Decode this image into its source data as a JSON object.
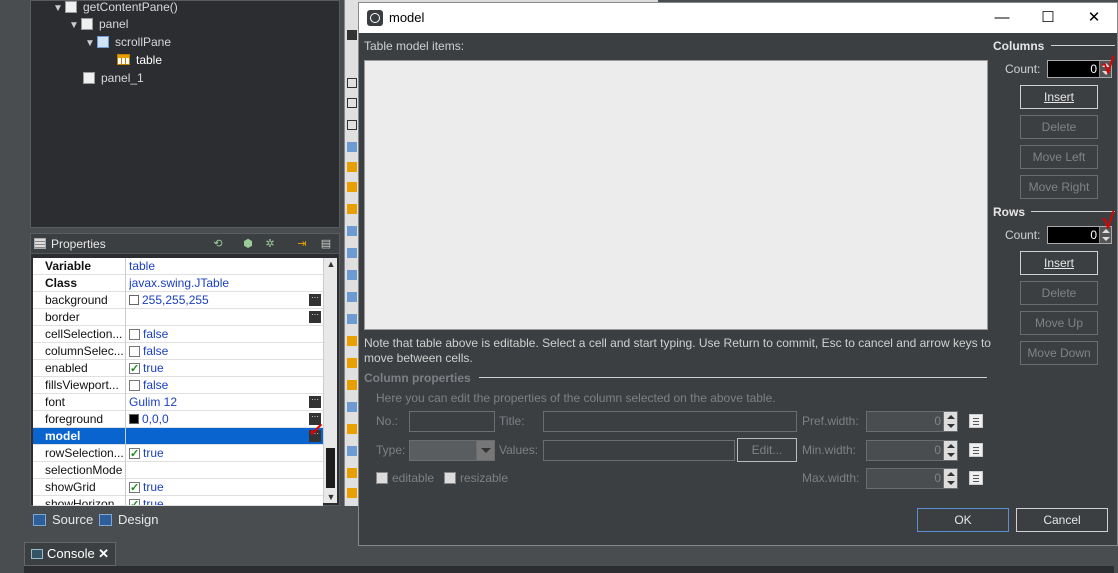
{
  "tree": {
    "items": [
      {
        "label": "getContentPane()"
      },
      {
        "label": "panel"
      },
      {
        "label": "scrollPane"
      },
      {
        "label": "table"
      },
      {
        "label": "panel_1"
      }
    ]
  },
  "properties": {
    "title": "Properties",
    "rows": [
      {
        "name": "Variable",
        "value": "table"
      },
      {
        "name": "Class",
        "value": "javax.swing.JTable"
      },
      {
        "name": "background",
        "value": "255,255,255"
      },
      {
        "name": "border",
        "value": ""
      },
      {
        "name": "cellSelection...",
        "value": "false"
      },
      {
        "name": "columnSelec...",
        "value": "false"
      },
      {
        "name": "enabled",
        "value": "true"
      },
      {
        "name": "fillsViewport...",
        "value": "false"
      },
      {
        "name": "font",
        "value": "Gulim 12"
      },
      {
        "name": "foreground",
        "value": "0,0,0"
      },
      {
        "name": "model",
        "value": ""
      },
      {
        "name": "rowSelection...",
        "value": "true"
      },
      {
        "name": "selectionMode",
        "value": ""
      },
      {
        "name": "showGrid",
        "value": "true"
      },
      {
        "name": "showHorizon...",
        "value": "true"
      }
    ]
  },
  "bottom_tabs": {
    "source": "Source",
    "design": "Design"
  },
  "console": {
    "label": "Console",
    "close": "✕"
  },
  "dialog": {
    "title": "model",
    "window_buttons": {
      "minimize": "—",
      "maximize": "☐",
      "close": "✕"
    },
    "table_label": "Table model items:",
    "note": "Note that table above is editable. Select a cell and start typing. Use Return to commit, Esc to cancel and arrow keys to move between cells.",
    "columns": {
      "title": "Columns",
      "count_label": "Count:",
      "count": "0",
      "insert": "Insert",
      "delete": "Delete",
      "move_left": "Move Left",
      "move_right": "Move Right"
    },
    "rows": {
      "title": "Rows",
      "count_label": "Count:",
      "count": "0",
      "insert": "Insert",
      "delete": "Delete",
      "move_up": "Move Up",
      "move_down": "Move Down"
    },
    "column_properties": {
      "title": "Column properties",
      "hint": "Here you can edit the properties of the column selected on the above table.",
      "no_label": "No.:",
      "title_label": "Title:",
      "pref_width_label": "Pref.width:",
      "pref_width": "0",
      "type_label": "Type:",
      "values_label": "Values:",
      "edit_button": "Edit...",
      "min_width_label": "Min.width:",
      "min_width": "0",
      "editable_label": "editable",
      "resizable_label": "resizable",
      "max_width_label": "Max.width:",
      "max_width": "0"
    },
    "ok": "OK",
    "cancel": "Cancel"
  }
}
